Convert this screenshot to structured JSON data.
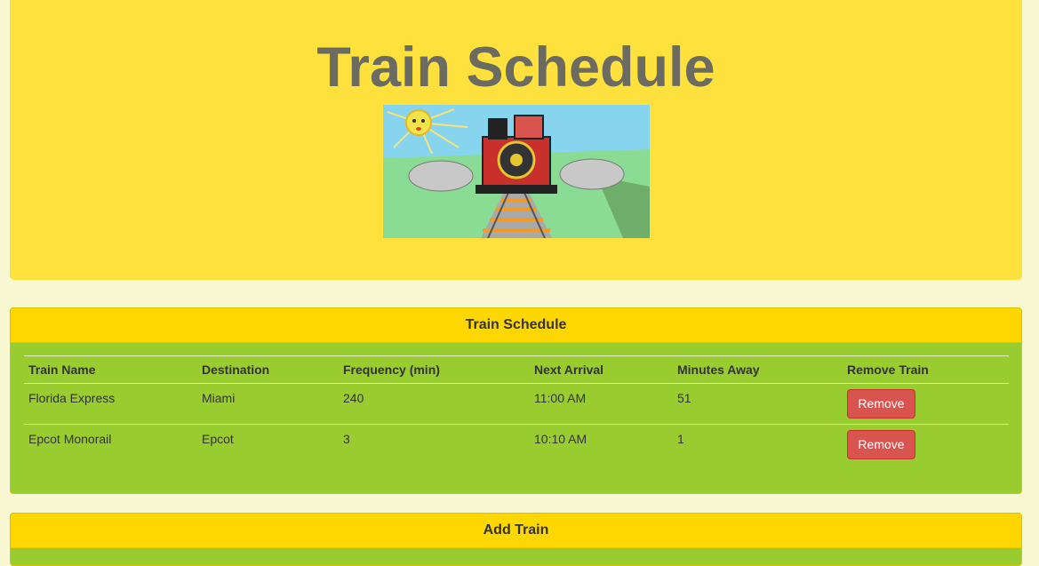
{
  "header": {
    "title": "Train Schedule",
    "image": "train-picture"
  },
  "schedule_panel": {
    "heading": "Train Schedule",
    "columns": [
      "Train Name",
      "Destination",
      "Frequency (min)",
      "Next Arrival",
      "Minutes Away",
      "Remove Train"
    ],
    "rows": [
      {
        "name": "Florida Express",
        "destination": "Miami",
        "frequency": "240",
        "next_arrival": "11:00 AM",
        "minutes_away": "51",
        "remove_label": "Remove"
      },
      {
        "name": "Epcot Monorail",
        "destination": "Epcot",
        "frequency": "3",
        "next_arrival": "10:10 AM",
        "minutes_away": "1",
        "remove_label": "Remove"
      }
    ]
  },
  "add_panel": {
    "heading": "Add Train"
  },
  "colors": {
    "page_background": "#F8F8D2",
    "jumbotron": "#FEE13D",
    "panel_heading": "#FFD700",
    "panel_body": "#99CC2E",
    "remove_button": "#D9534F",
    "title_text": "#6B6B62"
  }
}
